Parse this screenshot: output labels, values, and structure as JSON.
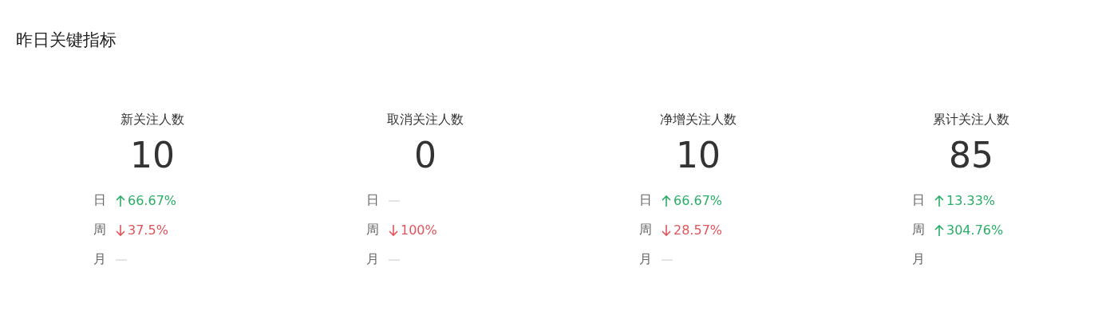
{
  "title": "昨日关键指标",
  "metrics": [
    {
      "label": "新关注人数",
      "value": "10",
      "changes": [
        {
          "period": "日",
          "kind": "rise",
          "value": "66.67%"
        },
        {
          "period": "周",
          "kind": "fall",
          "value": "37.5%"
        },
        {
          "period": "月",
          "kind": "empty"
        }
      ]
    },
    {
      "label": "取消关注人数",
      "value": "0",
      "changes": [
        {
          "period": "日",
          "kind": "empty"
        },
        {
          "period": "周",
          "kind": "fall",
          "value": "100%"
        },
        {
          "period": "月",
          "kind": "empty"
        }
      ]
    },
    {
      "label": "净增关注人数",
      "value": "10",
      "changes": [
        {
          "period": "日",
          "kind": "rise",
          "value": "66.67%"
        },
        {
          "period": "周",
          "kind": "fall",
          "value": "28.57%"
        },
        {
          "period": "月",
          "kind": "empty"
        }
      ]
    },
    {
      "label": "累计关注人数",
      "value": "85",
      "changes": [
        {
          "period": "日",
          "kind": "rise",
          "value": "13.33%"
        },
        {
          "period": "周",
          "kind": "rise",
          "value": "304.76%"
        },
        {
          "period": "月",
          "kind": "covered"
        }
      ]
    }
  ]
}
